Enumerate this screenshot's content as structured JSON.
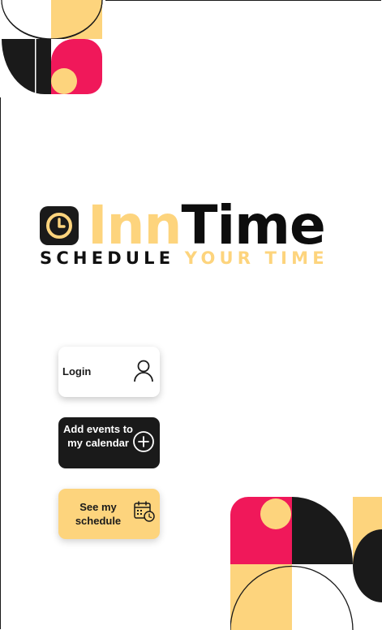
{
  "brand": {
    "name_part1": "Inn",
    "name_part2": "Time",
    "tagline_part1": "SCHEDULE ",
    "tagline_part2": "YOUR TIME"
  },
  "buttons": {
    "login": {
      "label": "Login",
      "icon": "user-icon"
    },
    "add_events": {
      "label": "Add events to my calendar",
      "icon": "plus-circle-icon"
    },
    "see_schedule": {
      "label": "See my schedule",
      "icon": "calendar-clock-icon"
    }
  },
  "colors": {
    "accent_yellow": "#fdd47d",
    "accent_pink": "#f0185a",
    "dark": "#1a1a1a",
    "background": "#ffffff"
  }
}
